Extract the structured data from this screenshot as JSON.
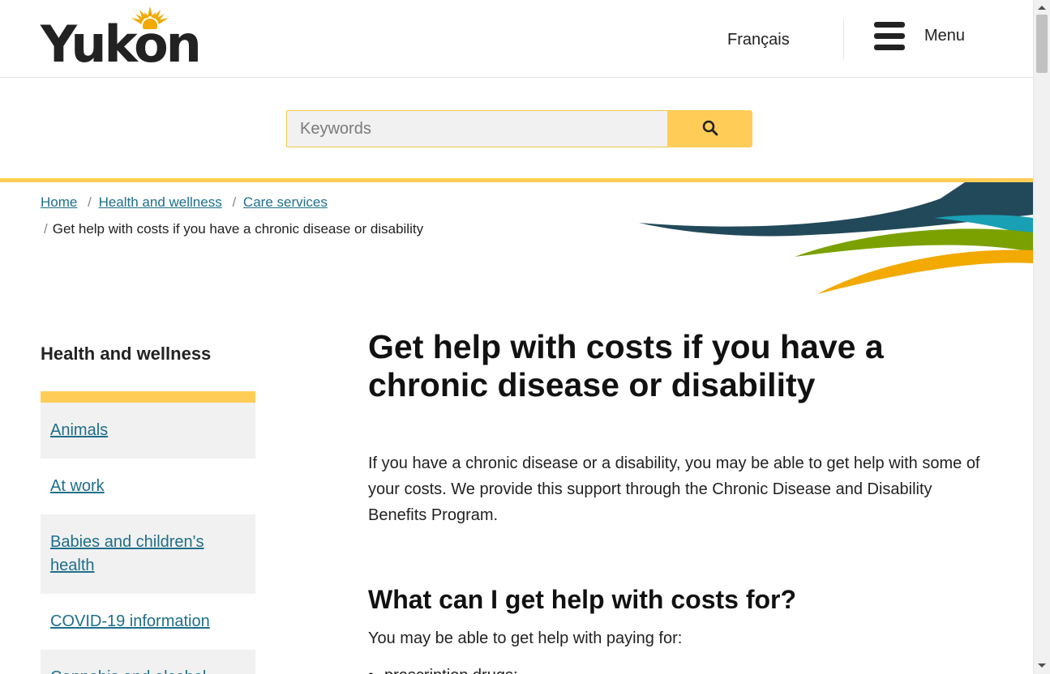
{
  "header": {
    "logo_text": "Yukon",
    "language_link": "Français",
    "menu_label": "Menu"
  },
  "search": {
    "placeholder": "Keywords",
    "value": ""
  },
  "breadcrumb": {
    "items": [
      "Home",
      "Health and wellness",
      "Care services"
    ],
    "separator": "/",
    "current": "Get help with costs if you have a chronic disease or disability"
  },
  "sidebar": {
    "title": "Health and wellness",
    "items": [
      {
        "label": "Animals"
      },
      {
        "label": "At work"
      },
      {
        "label": "Babies and children's health"
      },
      {
        "label": "COVID-19 information"
      },
      {
        "label": "Cannabis and alcohol"
      }
    ]
  },
  "main": {
    "title": "Get help with costs if you have a chronic disease or disability",
    "intro": "If you have a chronic disease or a disability, you may be able to get help with some of your costs. We provide this support through the Chronic Disease and Disability Benefits Program.",
    "section_heading": "What can I get help with costs for?",
    "section_intro": "You may be able to get help with paying for:",
    "list": [
      "prescription drugs;"
    ]
  },
  "colors": {
    "accent_yellow": "#ffcd57",
    "link_teal": "#1e6f8a",
    "wave_navy": "#22495a",
    "wave_teal": "#1aa0b4",
    "wave_green": "#7ba100",
    "wave_orange": "#f2a900"
  }
}
